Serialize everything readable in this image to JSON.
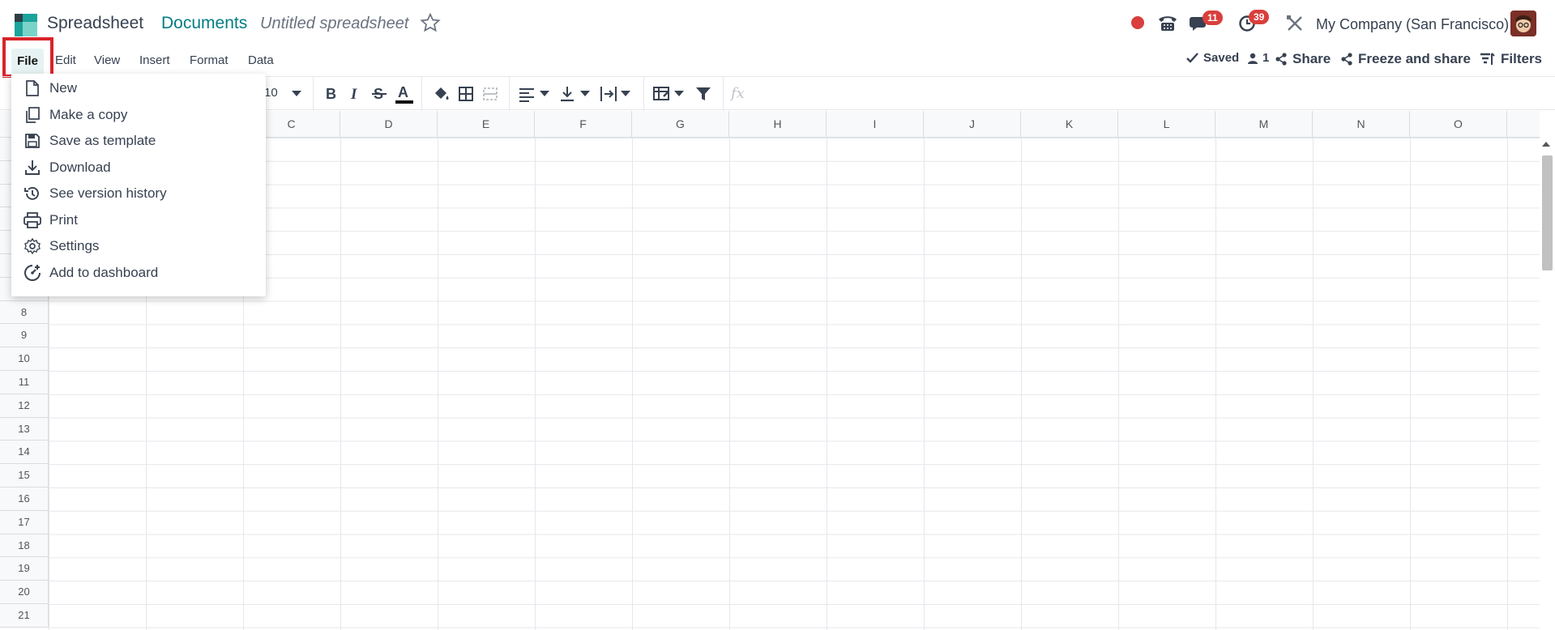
{
  "header": {
    "app_name": "Spreadsheet",
    "breadcrumb": "Documents",
    "doc_title": "Untitled spreadsheet",
    "chat_badge": "11",
    "activity_badge": "39",
    "company": "My Company (San Francisco)"
  },
  "menubar": {
    "file": "File",
    "edit": "Edit",
    "view": "View",
    "insert": "Insert",
    "format": "Format",
    "data": "Data"
  },
  "actions": {
    "saved": "Saved",
    "users_count": "1",
    "share": "Share",
    "freeze_share": "Freeze and share",
    "filters": "Filters"
  },
  "toolbar": {
    "font_size": "10",
    "fx": "fx"
  },
  "file_menu": {
    "items": [
      {
        "label": "New",
        "icon": "file-icon"
      },
      {
        "label": "Make a copy",
        "icon": "copy-icon"
      },
      {
        "label": "Save as template",
        "icon": "save-icon"
      },
      {
        "label": "Download",
        "icon": "download-icon"
      },
      {
        "label": "See version history",
        "icon": "history-icon"
      },
      {
        "label": "Print",
        "icon": "print-icon"
      },
      {
        "label": "Settings",
        "icon": "gear-icon"
      },
      {
        "label": "Add to dashboard",
        "icon": "dashboard-icon"
      }
    ]
  },
  "grid": {
    "columns": [
      "C",
      "D",
      "E",
      "F",
      "G",
      "H",
      "I",
      "J",
      "K",
      "L",
      "M",
      "N",
      "O"
    ],
    "rows": [
      "8",
      "9",
      "10",
      "11",
      "12",
      "13",
      "14",
      "15",
      "16",
      "17",
      "18",
      "19",
      "20",
      "21"
    ]
  },
  "colors": {
    "brand_teal": "#017e84",
    "badge_red": "#d93f3c",
    "highlight_red": "#d8242a"
  }
}
